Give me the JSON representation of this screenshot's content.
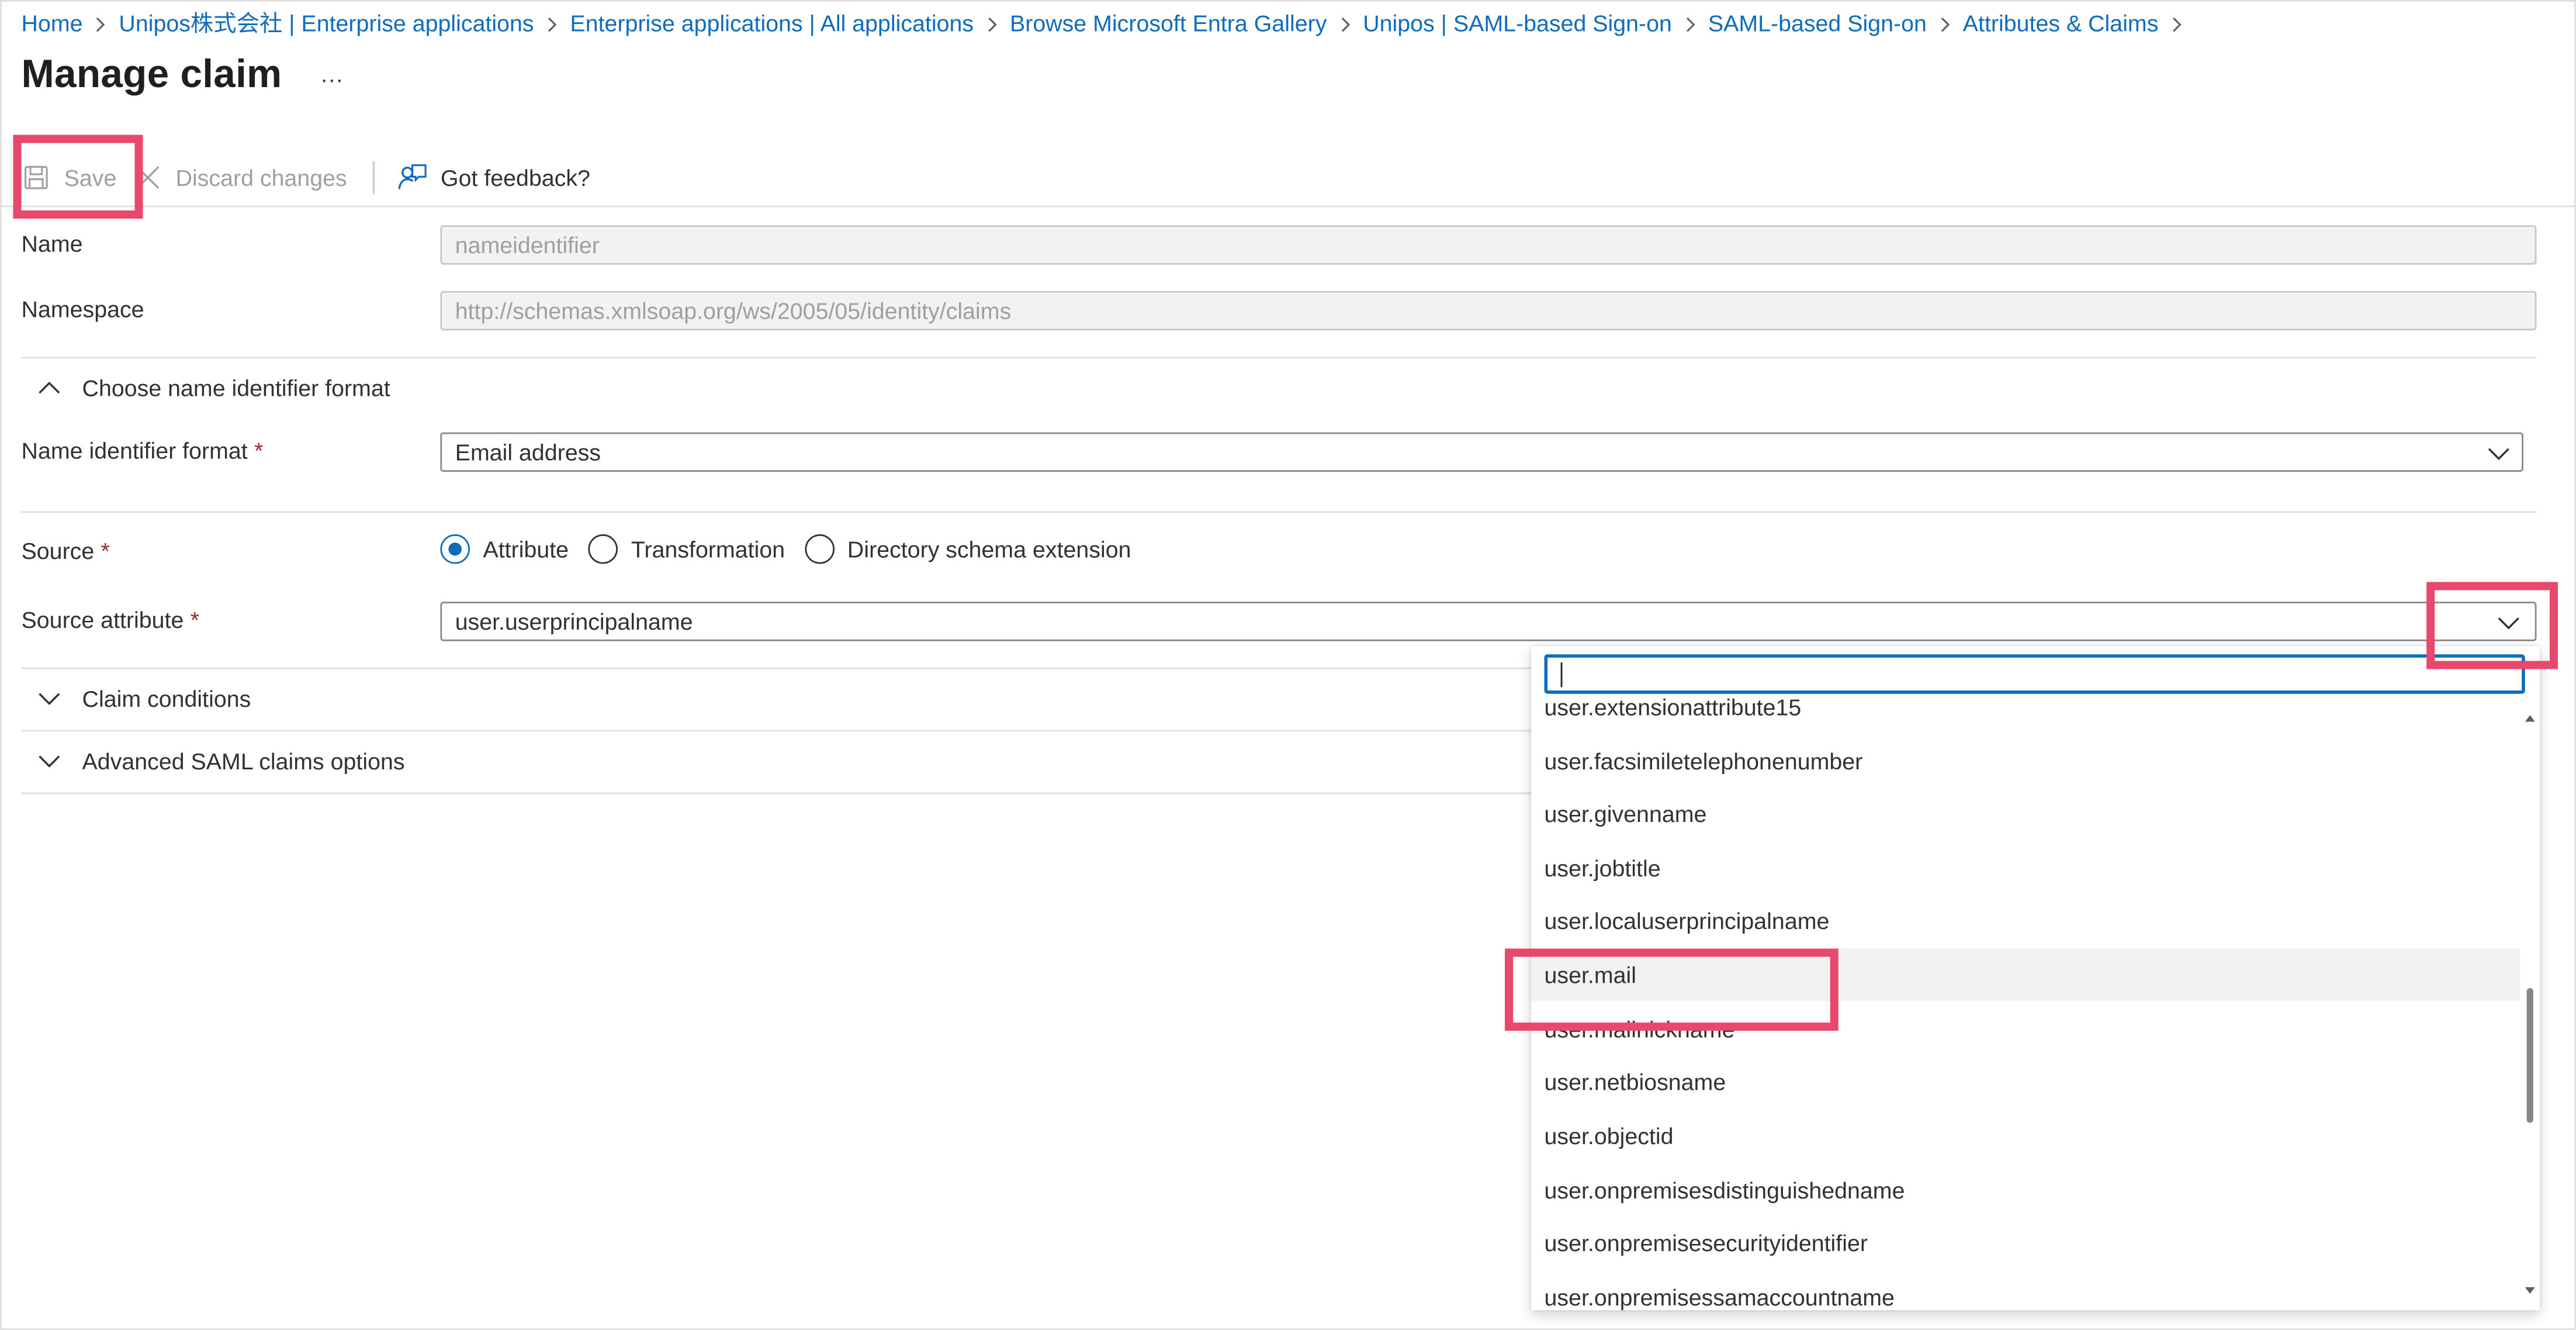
{
  "breadcrumb": [
    {
      "label": "Home"
    },
    {
      "label": "Unipos株式会社 | Enterprise applications"
    },
    {
      "label": "Enterprise applications | All applications"
    },
    {
      "label": "Browse Microsoft Entra Gallery"
    },
    {
      "label": "Unipos | SAML-based Sign-on"
    },
    {
      "label": "SAML-based Sign-on"
    },
    {
      "label": "Attributes & Claims"
    }
  ],
  "page": {
    "title": "Manage claim",
    "more_label": "···"
  },
  "toolbar": {
    "save_label": "Save",
    "discard_label": "Discard changes",
    "feedback_label": "Got feedback?"
  },
  "form": {
    "name_label": "Name",
    "name_value": "nameidentifier",
    "namespace_label": "Namespace",
    "namespace_value": "http://schemas.xmlsoap.org/ws/2005/05/identity/claims",
    "name_id_section_label": "Choose name identifier format",
    "name_id_format_label": "Name identifier format",
    "name_id_format_value": "Email address",
    "source_label": "Source",
    "source_options": [
      {
        "label": "Attribute",
        "checked": true
      },
      {
        "label": "Transformation",
        "checked": false
      },
      {
        "label": "Directory schema extension",
        "checked": false
      }
    ],
    "source_attribute_label": "Source attribute",
    "source_attribute_value": "user.userprincipalname",
    "required_mark": "*",
    "claim_conditions_label": "Claim conditions",
    "advanced_label": "Advanced SAML claims options"
  },
  "dropdown": {
    "search_value": "",
    "items": [
      "user.extensionattribute15",
      "user.facsimiletelephonenumber",
      "user.givenname",
      "user.jobtitle",
      "user.localuserprincipalname",
      "user.mail",
      "user.mailnickname",
      "user.netbiosname",
      "user.objectid",
      "user.onpremisesdistinguishedname",
      "user.onpremisesecurityidentifier",
      "user.onpremisessamaccountname"
    ],
    "hovered_item": "user.mail"
  },
  "colors": {
    "link": "#0f6cbd",
    "required": "#a4262c",
    "highlight": "#e8486b",
    "hover_row": "#f3f2f1"
  },
  "icons": {
    "save": "save-icon",
    "discard": "close-icon",
    "feedback": "feedback-icon",
    "chevron": "chevron-down-icon",
    "section_open": "chevron-up-icon",
    "section_closed": "chevron-down-icon"
  }
}
